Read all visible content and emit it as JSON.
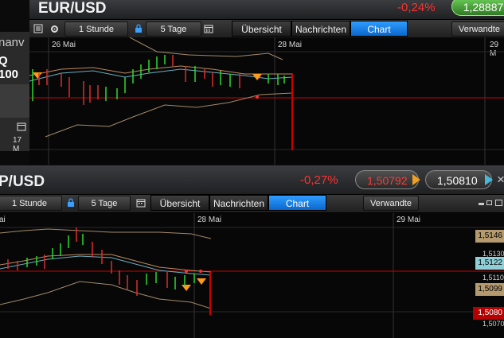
{
  "top": {
    "title": "EUR/USD",
    "change": "-0,24%",
    "price_pill": "1,28887",
    "toolbar": {
      "interval": "1 Stunde",
      "range": "5 Tage"
    },
    "tabs": [
      "Übersicht",
      "Nachrichten",
      "Chart"
    ],
    "related": "Verwandte",
    "dates": [
      "26 Mai",
      "28 Mai",
      "29 M"
    ]
  },
  "left_panel": {
    "partial_title": "nanv",
    "partial_value": "Q 100",
    "date": "17 M"
  },
  "bottom": {
    "title": "P/USD",
    "change": "-0,27%",
    "sell": "1,50792",
    "buy": "1,50810",
    "close_glyph": "×",
    "toolbar": {
      "interval": "1 Stunde",
      "range": "5 Tage"
    },
    "tabs": [
      "Übersicht",
      "Nachrichten",
      "Chart"
    ],
    "related": "Verwandte",
    "dates": [
      "ai",
      "28 Mai",
      "29 Mai"
    ],
    "price_labels": [
      "1,5146",
      "1,5130",
      "1,5122",
      "1,5110",
      "1,5099",
      "1,5080",
      "1,5070"
    ]
  },
  "colors": {
    "accent_blue": "#1e88ff",
    "negative": "#ff3030",
    "positive_pill": "#4a9a3a",
    "gold_badge": "#b49a6e",
    "teal_badge": "#8fd0d8",
    "red_badge": "#b50000"
  }
}
